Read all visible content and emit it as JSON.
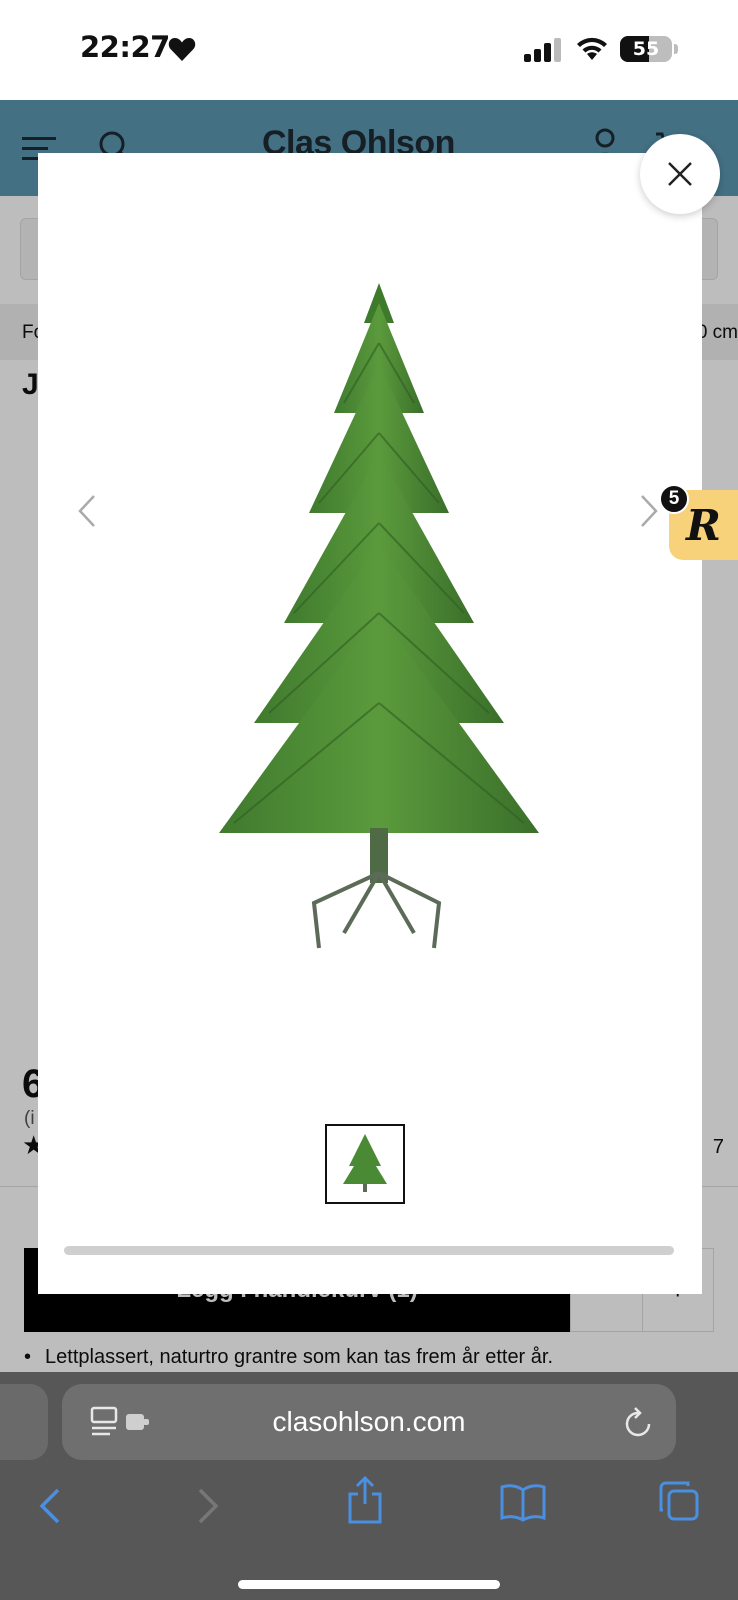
{
  "status_bar": {
    "time": "22:27",
    "battery": "55",
    "battery_level": 0.55
  },
  "site_header": {
    "logo": "Clas Ohlson"
  },
  "page": {
    "breadcrumb_left": "Fo",
    "breadcrumb_right": "0 cm",
    "title_peek": "J",
    "price_peek": "6",
    "incl_peek": "(i",
    "star_peek": "★",
    "reviews_peek": "7",
    "add_to_cart_label": "Legg i handlekurv (1)",
    "qty_minus": "-",
    "qty_plus": "+",
    "bullet": "Lettplassert, naturtro grantre som kan tas frem år etter år."
  },
  "modal": {
    "image": "christmas-tree-product",
    "thumbnail_count": 1
  },
  "rewards": {
    "count": "5",
    "letter": "R",
    "color": "#f8d27b"
  },
  "browser": {
    "address": "clasohlson.com"
  },
  "colors": {
    "header_bg": "#5b97b1",
    "safari_bar": "#575757",
    "ios_blue": "#4a8fe0"
  }
}
